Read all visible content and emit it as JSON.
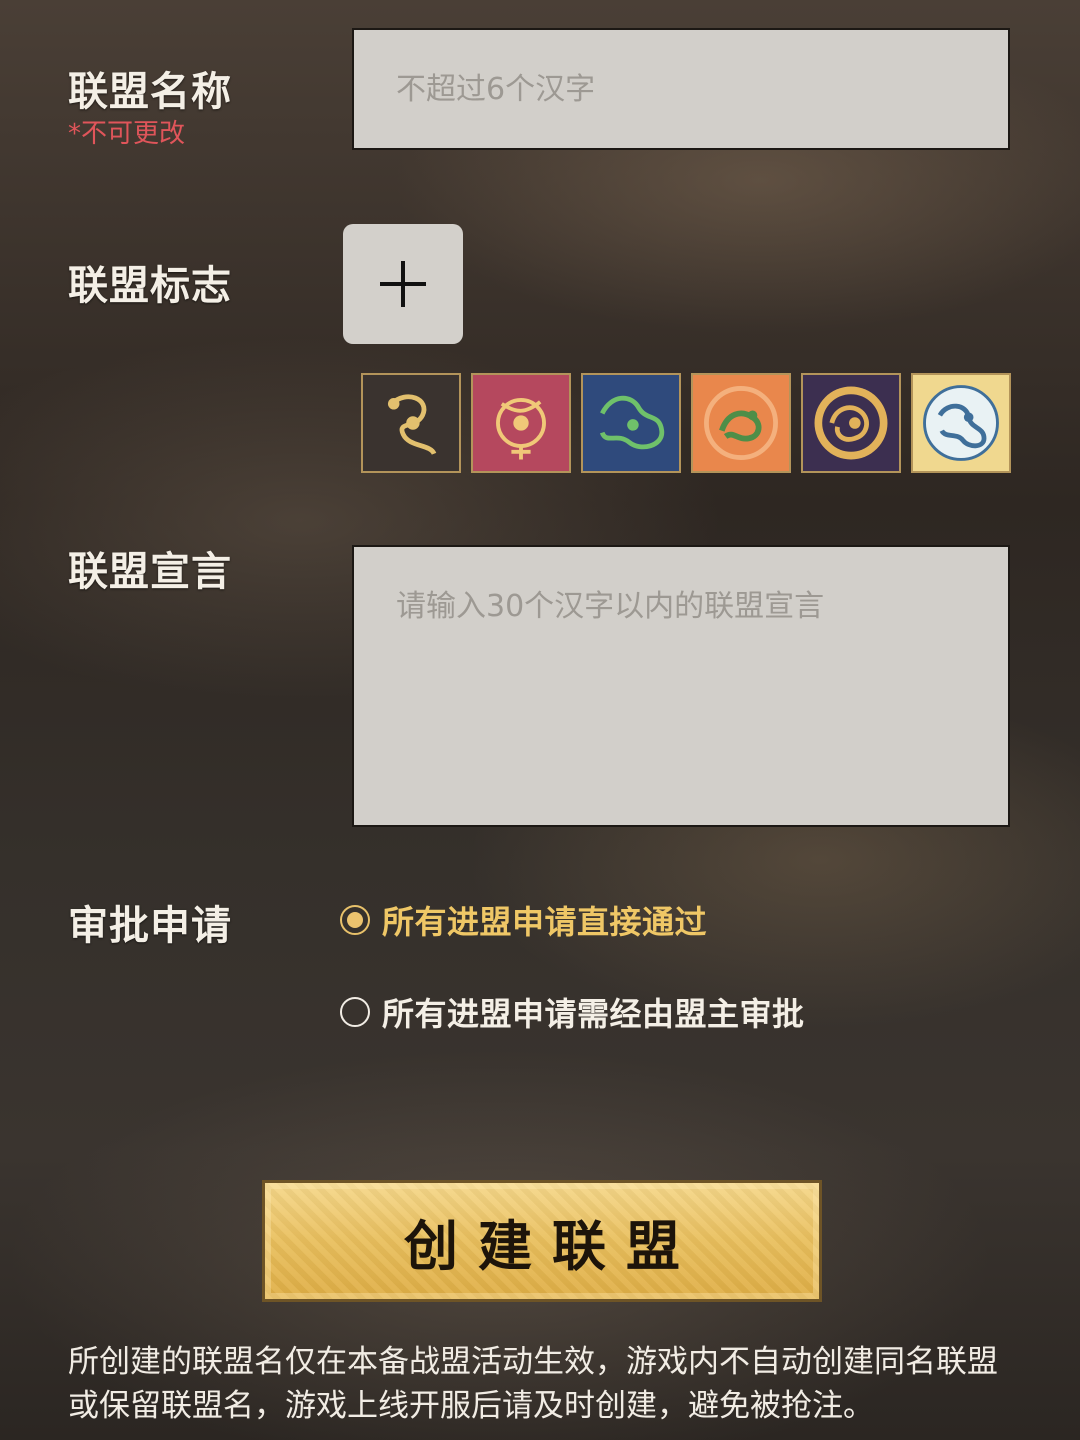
{
  "name_section": {
    "label": "联盟名称",
    "note": "*不可更改",
    "placeholder": "不超过6个汉字"
  },
  "logo_section": {
    "label": "联盟标志",
    "add_icon": "plus-icon",
    "emblems": [
      {
        "icon": "dragon-emblem-icon",
        "bg": "#3a332f",
        "fg": "#e2c06e"
      },
      {
        "icon": "phoenix-emblem-icon",
        "bg": "#b5485e",
        "fg": "#f0c878"
      },
      {
        "icon": "tiger-emblem-icon",
        "bg": "#2f4a7c",
        "fg": "#6fc16a"
      },
      {
        "icon": "qilin-emblem-icon",
        "bg": "#e9874c",
        "fg": "#4e8e48"
      },
      {
        "icon": "tortoise-emblem-icon",
        "bg": "#3c2f50",
        "fg": "#e2b25a"
      },
      {
        "icon": "serpent-emblem-icon",
        "bg": "#f0d88f",
        "fg": "#3f6f9a"
      }
    ]
  },
  "manifesto_section": {
    "label": "联盟宣言",
    "placeholder": "请输入30个汉字以内的联盟宣言"
  },
  "approval_section": {
    "label": "审批申请",
    "options": [
      {
        "text": "所有进盟申请直接通过",
        "selected": true
      },
      {
        "text": "所有进盟申请需经由盟主审批",
        "selected": false
      }
    ]
  },
  "create_button": {
    "label": "创建联盟"
  },
  "footer_note": "所创建的联盟名仅在本备战盟活动生效，游戏内不自动创建同名联盟或保留联盟名，游戏上线开服后请及时创建，避免被抢注。",
  "colors": {
    "accent_gold": "#efc766",
    "warning_red": "#e0555a",
    "field_bg": "#d2cfca"
  }
}
